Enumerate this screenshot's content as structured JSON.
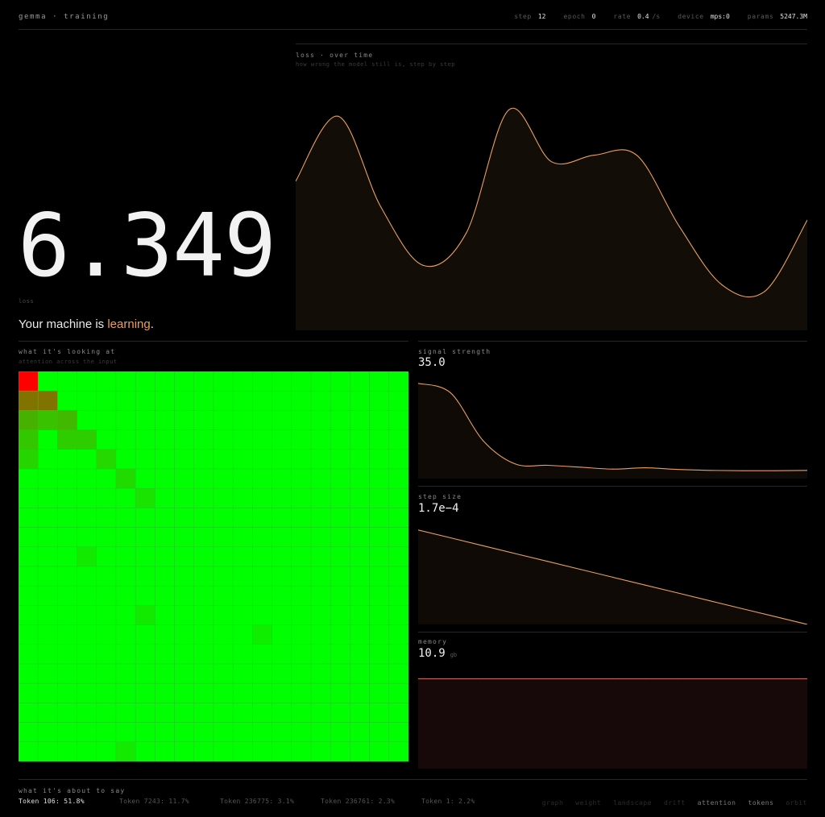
{
  "header": {
    "title": "gemma · training",
    "stats": [
      {
        "key": "step",
        "value": "12",
        "unit": ""
      },
      {
        "key": "epoch",
        "value": "0",
        "unit": ""
      },
      {
        "key": "rate",
        "value": "0.4",
        "unit": "/s"
      },
      {
        "key": "device",
        "value": "mps:0",
        "unit": ""
      },
      {
        "key": "params",
        "value": "5247.3M",
        "unit": ""
      }
    ]
  },
  "hero": {
    "loss_value": "6.349",
    "loss_label": "loss",
    "status_prefix": "Your machine is ",
    "status_word": "learning",
    "status_suffix": "."
  },
  "colors": {
    "accent": "#e8a05f",
    "memory": "#c46a5a",
    "heat_hot": "#ff0000",
    "heat_cold": "#00ff00"
  },
  "loss_chart": {
    "title": "loss · over time",
    "subtitle": "how wrong the model still is, step by step"
  },
  "attention": {
    "title": "what it's looking at",
    "subtitle": "attention across the input"
  },
  "signal": {
    "title": "signal strength",
    "value": "35.0"
  },
  "step_size": {
    "title": "step size",
    "value": "1.7e−4"
  },
  "memory": {
    "title": "memory",
    "value": "10.9",
    "unit": "gb"
  },
  "chart_data": [
    {
      "type": "area",
      "title": "loss · over time",
      "x": [
        0,
        1,
        2,
        3,
        4,
        5,
        6,
        7,
        8,
        9,
        10,
        11,
        12
      ],
      "values": [
        6.9,
        7.9,
        6.5,
        5.6,
        6.1,
        8.0,
        7.2,
        7.3,
        7.3,
        6.2,
        5.3,
        5.2,
        6.3
      ],
      "ylim": [
        4.6,
        8.5
      ]
    },
    {
      "type": "area",
      "title": "signal strength",
      "x": [
        0,
        1,
        2,
        3,
        4,
        5,
        6,
        7,
        8,
        9,
        10,
        11,
        12
      ],
      "values": [
        35.0,
        32.0,
        17.0,
        9.6,
        9.2,
        8.6,
        8.0,
        8.4,
        7.9,
        7.6,
        7.5,
        7.5,
        7.6
      ],
      "ylim": [
        5,
        38
      ]
    },
    {
      "type": "area",
      "title": "step size",
      "x": [
        0,
        1,
        2,
        3,
        4,
        5,
        6,
        7,
        8,
        9,
        10,
        11,
        12
      ],
      "values": [
        2.0,
        1.9,
        1.8,
        1.7,
        1.6,
        1.5,
        1.4,
        1.3,
        1.2,
        1.1,
        1.0,
        0.9,
        0.8
      ],
      "ylim": [
        0.8,
        2.1
      ]
    },
    {
      "type": "area",
      "title": "memory",
      "x": [
        0,
        1,
        2,
        3,
        4,
        5,
        6,
        7,
        8,
        9,
        10,
        11,
        12
      ],
      "values": [
        10.9,
        10.9,
        10.9,
        10.9,
        10.9,
        10.9,
        10.9,
        10.9,
        10.9,
        10.9,
        10.9,
        10.9,
        10.9
      ],
      "ylim": [
        0,
        12.5
      ]
    },
    {
      "type": "heatmap",
      "title": "what it's looking at",
      "rows": 20,
      "cols": 20,
      "highlights": [
        {
          "row": 0,
          "col": 0,
          "value": 1.0
        },
        {
          "row": 1,
          "col": 0,
          "value": 0.5
        },
        {
          "row": 1,
          "col": 1,
          "value": 0.5
        },
        {
          "row": 2,
          "col": 0,
          "value": 0.28
        },
        {
          "row": 2,
          "col": 1,
          "value": 0.22
        },
        {
          "row": 2,
          "col": 2,
          "value": 0.25
        },
        {
          "row": 3,
          "col": 0,
          "value": 0.2
        },
        {
          "row": 3,
          "col": 2,
          "value": 0.18
        },
        {
          "row": 3,
          "col": 3,
          "value": 0.18
        },
        {
          "row": 4,
          "col": 0,
          "value": 0.15
        },
        {
          "row": 4,
          "col": 4,
          "value": 0.14
        },
        {
          "row": 5,
          "col": 5,
          "value": 0.13
        },
        {
          "row": 6,
          "col": 6,
          "value": 0.1
        },
        {
          "row": 9,
          "col": 3,
          "value": 0.07
        },
        {
          "row": 12,
          "col": 6,
          "value": 0.07
        },
        {
          "row": 13,
          "col": 12,
          "value": 0.06
        },
        {
          "row": 19,
          "col": 5,
          "value": 0.07
        }
      ]
    }
  ],
  "next_tokens": {
    "title": "what it's about to say",
    "items": [
      "Token 106: 51.8%",
      "Token 7243: 11.7%",
      "Token 236775: 3.1%",
      "Token 236761: 2.3%",
      "Token 1: 2.2%"
    ]
  },
  "tabs": [
    {
      "label": "graph",
      "active": false
    },
    {
      "label": "weight",
      "active": false
    },
    {
      "label": "landscape",
      "active": false
    },
    {
      "label": "drift",
      "active": false
    },
    {
      "label": "attention",
      "active": true
    },
    {
      "label": "tokens",
      "active": true
    },
    {
      "label": "orbit",
      "active": false
    }
  ]
}
